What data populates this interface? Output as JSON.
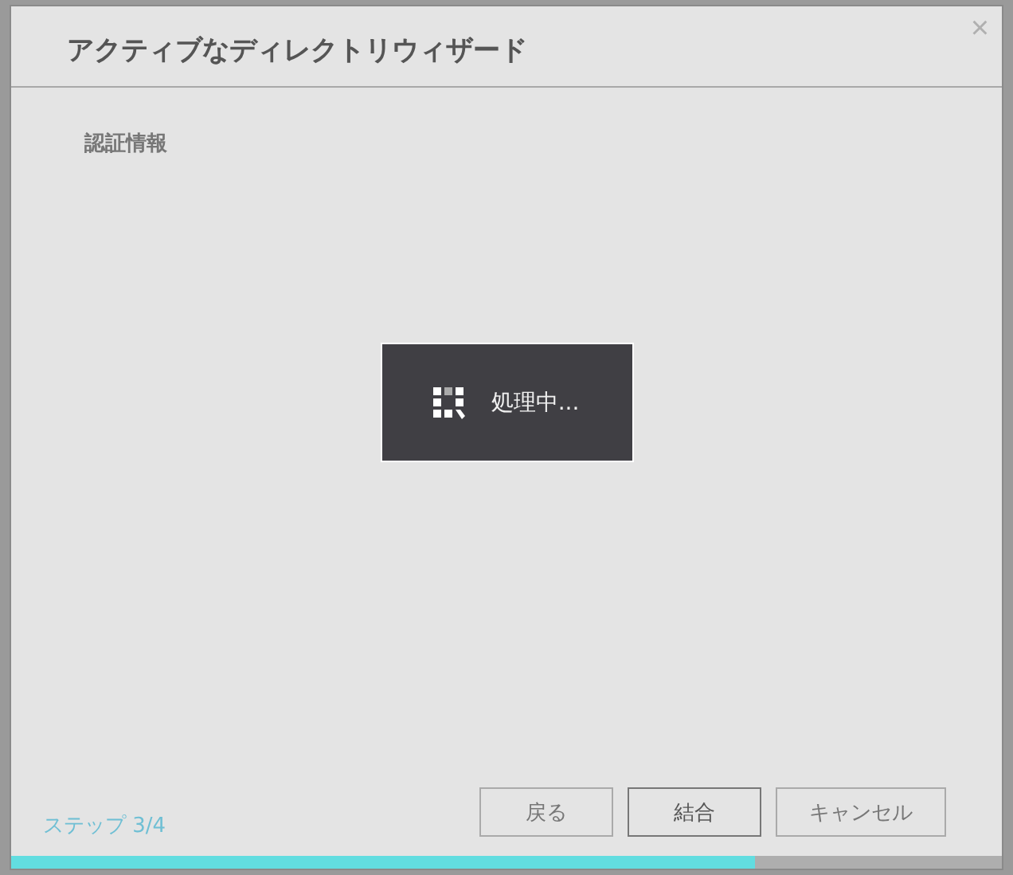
{
  "window": {
    "title": "アクティブなディレクトリウィザード",
    "close": "×"
  },
  "section": {
    "title": "認証情報"
  },
  "overlay": {
    "text": "処理中..."
  },
  "footer": {
    "step": "ステップ 3/4",
    "buttons": [
      {
        "label": "戻る",
        "focused": false
      },
      {
        "label": "結合",
        "focused": true
      },
      {
        "label": "キャンセル",
        "focused": false
      }
    ]
  },
  "progress": {
    "level": 0.75
  }
}
